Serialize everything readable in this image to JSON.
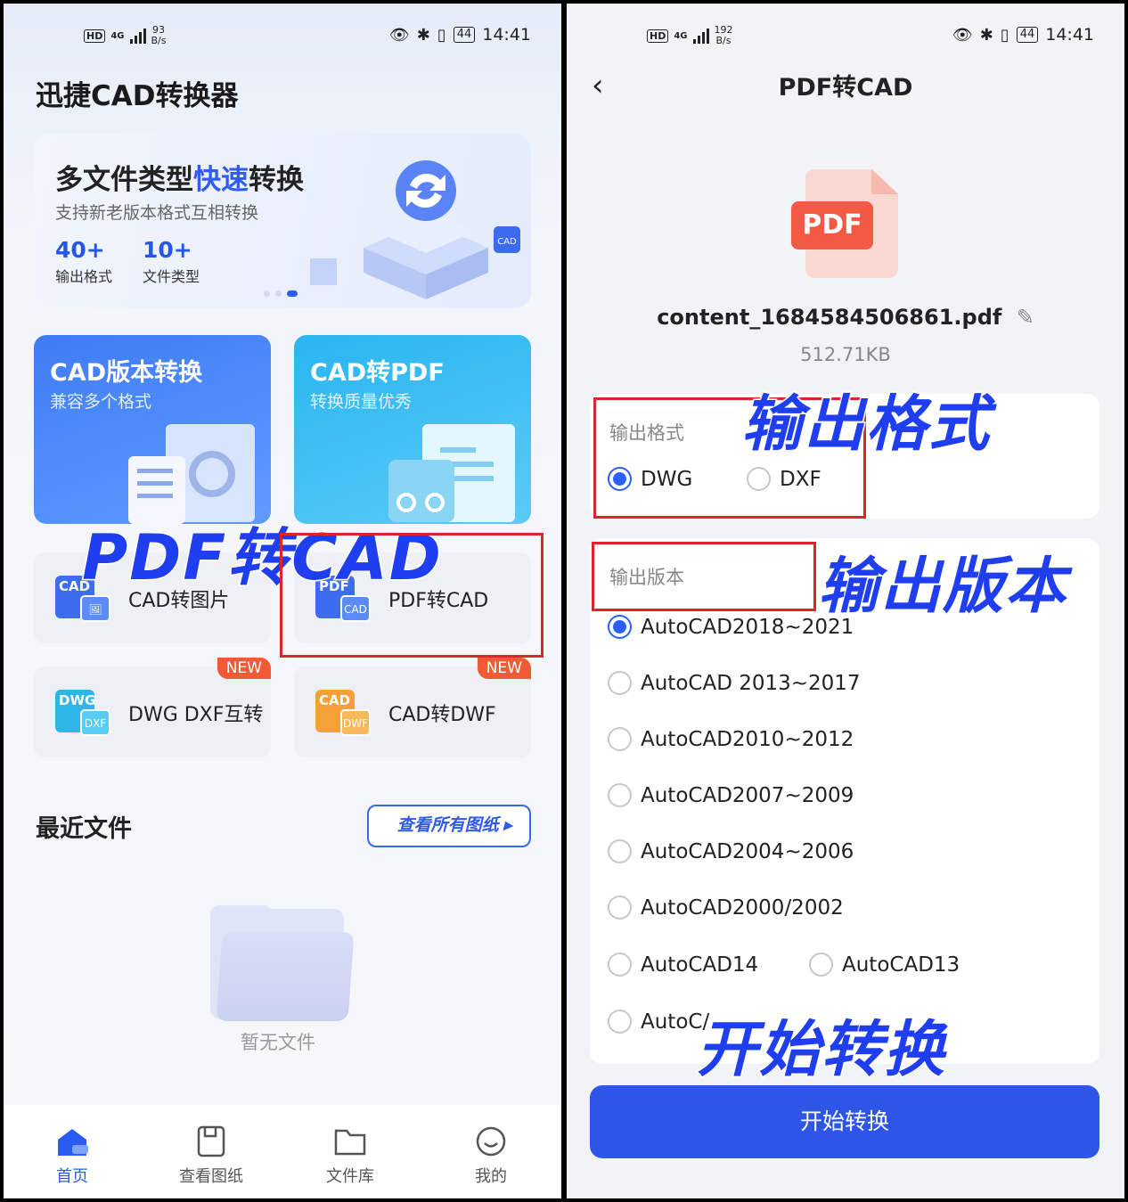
{
  "status_left": {
    "speed_num": "93",
    "speed_unit": "B/s",
    "time": "14:41",
    "battery": "44",
    "net": "4G",
    "hd": "HD"
  },
  "status_right": {
    "speed_num": "192",
    "speed_unit": "B/s",
    "time": "14:41",
    "battery": "44",
    "net": "4G",
    "hd": "HD"
  },
  "home": {
    "app_title": "迅捷CAD转换器",
    "banner": {
      "headline_a": "多文件类型",
      "headline_hl": "快速",
      "headline_b": "转换",
      "sub": "支持新老版本格式互相转换",
      "stat1_num": "40+",
      "stat1_label": "输出格式",
      "stat2_num": "10+",
      "stat2_label": "文件类型",
      "cad_badge": "CAD"
    },
    "card1": {
      "title": "CAD版本转换",
      "sub": "兼容多个格式"
    },
    "card2": {
      "title": "CAD转PDF",
      "sub": "转换质量优秀"
    },
    "tools": [
      {
        "label": "CAD转图片",
        "icon_a": "CAD",
        "icon_b": "🖼"
      },
      {
        "label": "PDF转CAD",
        "icon_a": "PDF",
        "icon_b": "CAD"
      },
      {
        "label": "DWG DXF互转",
        "icon_a": "DWG",
        "icon_b": "DXF",
        "badge": "NEW"
      },
      {
        "label": "CAD转DWF",
        "icon_a": "CAD",
        "icon_b": "DWF",
        "badge": "NEW"
      }
    ],
    "recent_title": "最近文件",
    "view_all": "查看所有图纸 ▸",
    "empty_text": "暂无文件",
    "tabs": [
      {
        "label": "首页"
      },
      {
        "label": "查看图纸"
      },
      {
        "label": "文件库"
      },
      {
        "label": "我的"
      }
    ],
    "annotation": "PDF转CAD"
  },
  "convert": {
    "nav_title": "PDF转CAD",
    "back": "‹",
    "pdf_tag": "PDF",
    "file_name": "content_1684584506861.pdf",
    "file_size": "512.71KB",
    "format_label": "输出格式",
    "formats": [
      {
        "label": "DWG",
        "selected": true
      },
      {
        "label": "DXF",
        "selected": false
      }
    ],
    "version_label": "输出版本",
    "versions": [
      {
        "label": "AutoCAD2018~2021",
        "selected": true
      },
      {
        "label": "AutoCAD 2013~2017",
        "selected": false
      },
      {
        "label": "AutoCAD2010~2012",
        "selected": false
      },
      {
        "label": "AutoCAD2007~2009",
        "selected": false
      },
      {
        "label": "AutoCAD2004~2006",
        "selected": false
      },
      {
        "label": "AutoCAD2000/2002",
        "selected": false
      },
      {
        "label": "AutoCAD14",
        "selected": false
      },
      {
        "label": "AutoCAD13",
        "selected": false
      },
      {
        "label": "AutoC/",
        "selected": false
      }
    ],
    "start_button": "开始转换",
    "anno_format": "输出格式",
    "anno_version": "输出版本",
    "anno_start": "开始转换"
  },
  "colors": {
    "accent": "#2d5ef5",
    "annotation": "#1f3ef0",
    "highlight_box": "#d9262c",
    "new_badge": "#f05a35"
  }
}
